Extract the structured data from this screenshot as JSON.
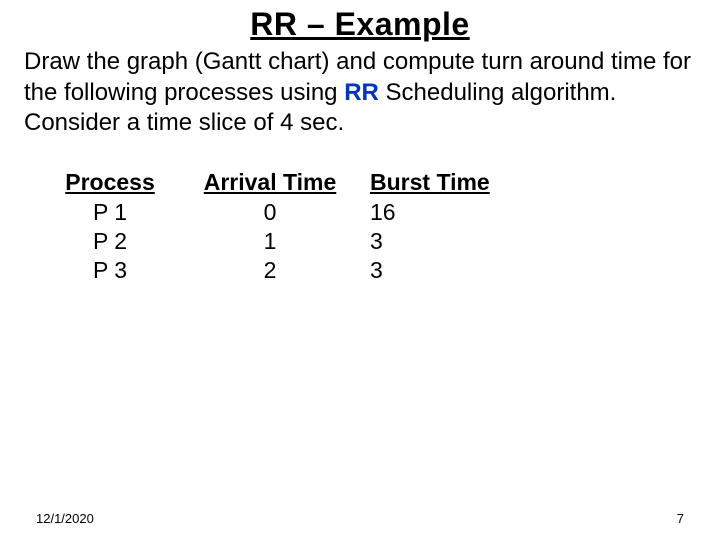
{
  "title": "RR – Example",
  "body_parts": {
    "pre": "Draw the graph (Gantt chart) and compute turn around time for the following processes using ",
    "accent": "RR",
    "post": " Scheduling algorithm. Consider a time slice of 4 sec."
  },
  "table": {
    "headers": {
      "process": "Process",
      "arrival": "Arrival Time",
      "burst": "Burst Time"
    },
    "rows": [
      {
        "process": "P 1",
        "arrival": "0",
        "burst": "16"
      },
      {
        "process": "P 2",
        "arrival": "1",
        "burst": "3"
      },
      {
        "process": "P 3",
        "arrival": "2",
        "burst": "3"
      }
    ]
  },
  "footer": {
    "date": "12/1/2020",
    "page": "7"
  },
  "chart_data": {
    "type": "table",
    "title": "RR – Example",
    "columns": [
      "Process",
      "Arrival Time",
      "Burst Time"
    ],
    "rows": [
      [
        "P 1",
        0,
        16
      ],
      [
        "P 2",
        1,
        3
      ],
      [
        "P 3",
        2,
        3
      ]
    ],
    "time_slice_sec": 4
  }
}
